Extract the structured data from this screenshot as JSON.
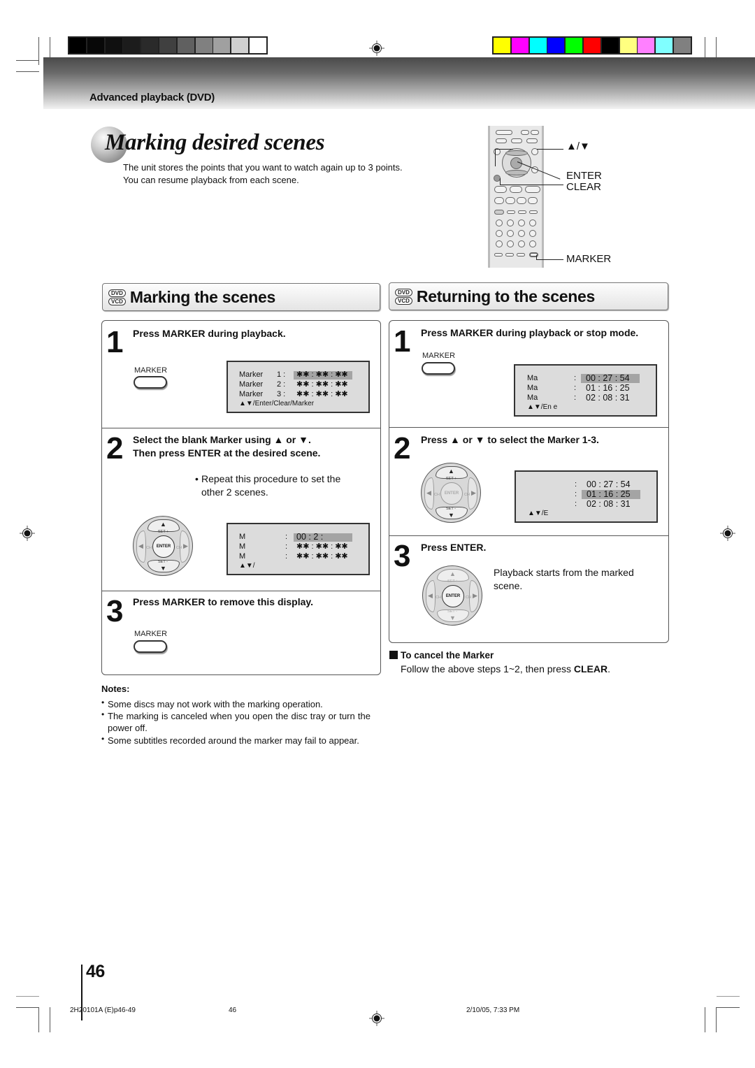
{
  "color_bars": {
    "grayscale": [
      "#000000",
      "#080808",
      "#101010",
      "#1c1c1c",
      "#2a2a2a",
      "#404040",
      "#606060",
      "#808080",
      "#a0a0a0",
      "#d0d0d0",
      "#ffffff"
    ],
    "colors": [
      "#ffff00",
      "#ff00ff",
      "#00ffff",
      "#0000ff",
      "#00ff00",
      "#ff0000",
      "#000000",
      "#ffff80",
      "#ff80ff",
      "#80ffff",
      "#808080"
    ]
  },
  "header": {
    "section_label": "Advanced playback (DVD)"
  },
  "title": "Marking desired scenes",
  "intro": {
    "line1": "The unit stores the points that you want to watch again up to 3 points.",
    "line2": "You can resume playback from each scene."
  },
  "remote_labels": {
    "arrows": "▲/▼",
    "enter": "ENTER",
    "clear": "CLEAR",
    "marker": "MARKER"
  },
  "left_section": {
    "badge_top": "DVD",
    "badge_bottom": "VCD",
    "title": "Marking the scenes",
    "step1": {
      "num": "1",
      "instruction": "Press MARKER during playback.",
      "button_label": "MARKER",
      "osd": {
        "rows": [
          {
            "label": "Marker",
            "index": "1 :",
            "value": "✱✱ : ✱✱ : ✱✱",
            "selected": true
          },
          {
            "label": "Marker",
            "index": "2 :",
            "value": "✱✱ : ✱✱ : ✱✱",
            "selected": false
          },
          {
            "label": "Marker",
            "index": "3 :",
            "value": "✱✱ : ✱✱ : ✱✱",
            "selected": false
          }
        ],
        "footer": "▲▼/Enter/Clear/Marker"
      }
    },
    "step2": {
      "num": "2",
      "instruction_line1": "Select the blank Marker using ▲ or ▼.",
      "instruction_line2": "Then press ENTER at the desired scene.",
      "bullet": "•",
      "note_line1": "Repeat this procedure to set the",
      "note_line2": "other 2 scenes.",
      "joystick": {
        "up": "SET +",
        "down": "SET -",
        "center": "ENTER",
        "left": "CH",
        "right": "CH"
      },
      "osd": {
        "rows": [
          {
            "label": "M",
            "colon": ":",
            "value": "00 : 2   :",
            "selected": true
          },
          {
            "label": "M",
            "colon": ":",
            "value": "✱✱ : ✱✱ : ✱✱",
            "selected": false
          },
          {
            "label": "M",
            "colon": ":",
            "value": "✱✱ : ✱✱ : ✱✱",
            "selected": false
          }
        ],
        "footer": "▲▼/"
      }
    },
    "step3": {
      "num": "3",
      "instruction": "Press MARKER to remove this display.",
      "button_label": "MARKER"
    }
  },
  "right_section": {
    "badge_top": "DVD",
    "badge_bottom": "VCD",
    "title": "Returning to the scenes",
    "step1": {
      "num": "1",
      "instruction": "Press MARKER during playback or stop mode.",
      "button_label": "MARKER",
      "osd": {
        "rows": [
          {
            "label": "Ma",
            "colon": ":",
            "value": "00 : 27 : 54",
            "selected": true
          },
          {
            "label": "Ma",
            "colon": ":",
            "value": "01 : 16 : 25",
            "selected": false
          },
          {
            "label": "Ma",
            "colon": ":",
            "value": "02 : 08 : 31",
            "selected": false
          }
        ],
        "footer": "▲▼/En e"
      }
    },
    "step2": {
      "num": "2",
      "instruction": "Press ▲ or ▼ to select the Marker 1-3.",
      "joystick": {
        "up": "SET +",
        "down": "SET -",
        "center": "ENTER",
        "left": "CH",
        "right": "CH"
      },
      "osd": {
        "rows": [
          {
            "colon": ":",
            "value": "00 : 27 : 54",
            "selected": false
          },
          {
            "colon": ":",
            "value": "01 : 16 : 25",
            "selected": true
          },
          {
            "colon": ":",
            "value": "02 : 08 : 31",
            "selected": false
          }
        ],
        "footer": "▲▼/E"
      }
    },
    "step3": {
      "num": "3",
      "instruction": "Press ENTER.",
      "desc_line1": "Playback starts from the marked",
      "desc_line2": "scene.",
      "joystick": {
        "up": "SET +",
        "down": "SET -",
        "center": "ENTER",
        "left": "CH",
        "right": "CH"
      }
    },
    "cancel": {
      "heading": "To cancel the Marker",
      "text_prefix": "Follow the above steps 1~2, then press ",
      "text_bold": "CLEAR",
      "text_suffix": "."
    }
  },
  "notes": {
    "heading": "Notes:",
    "items": [
      "Some discs may not work with the marking operation.",
      "The marking is canceled when you open the disc tray or turn the power off.",
      "Some subtitles recorded around the marker may fail to appear."
    ]
  },
  "page_number": "46",
  "footer": {
    "file": "2H20101A (E)p46-49",
    "page": "46",
    "date": "2/10/05, 7:33 PM"
  }
}
